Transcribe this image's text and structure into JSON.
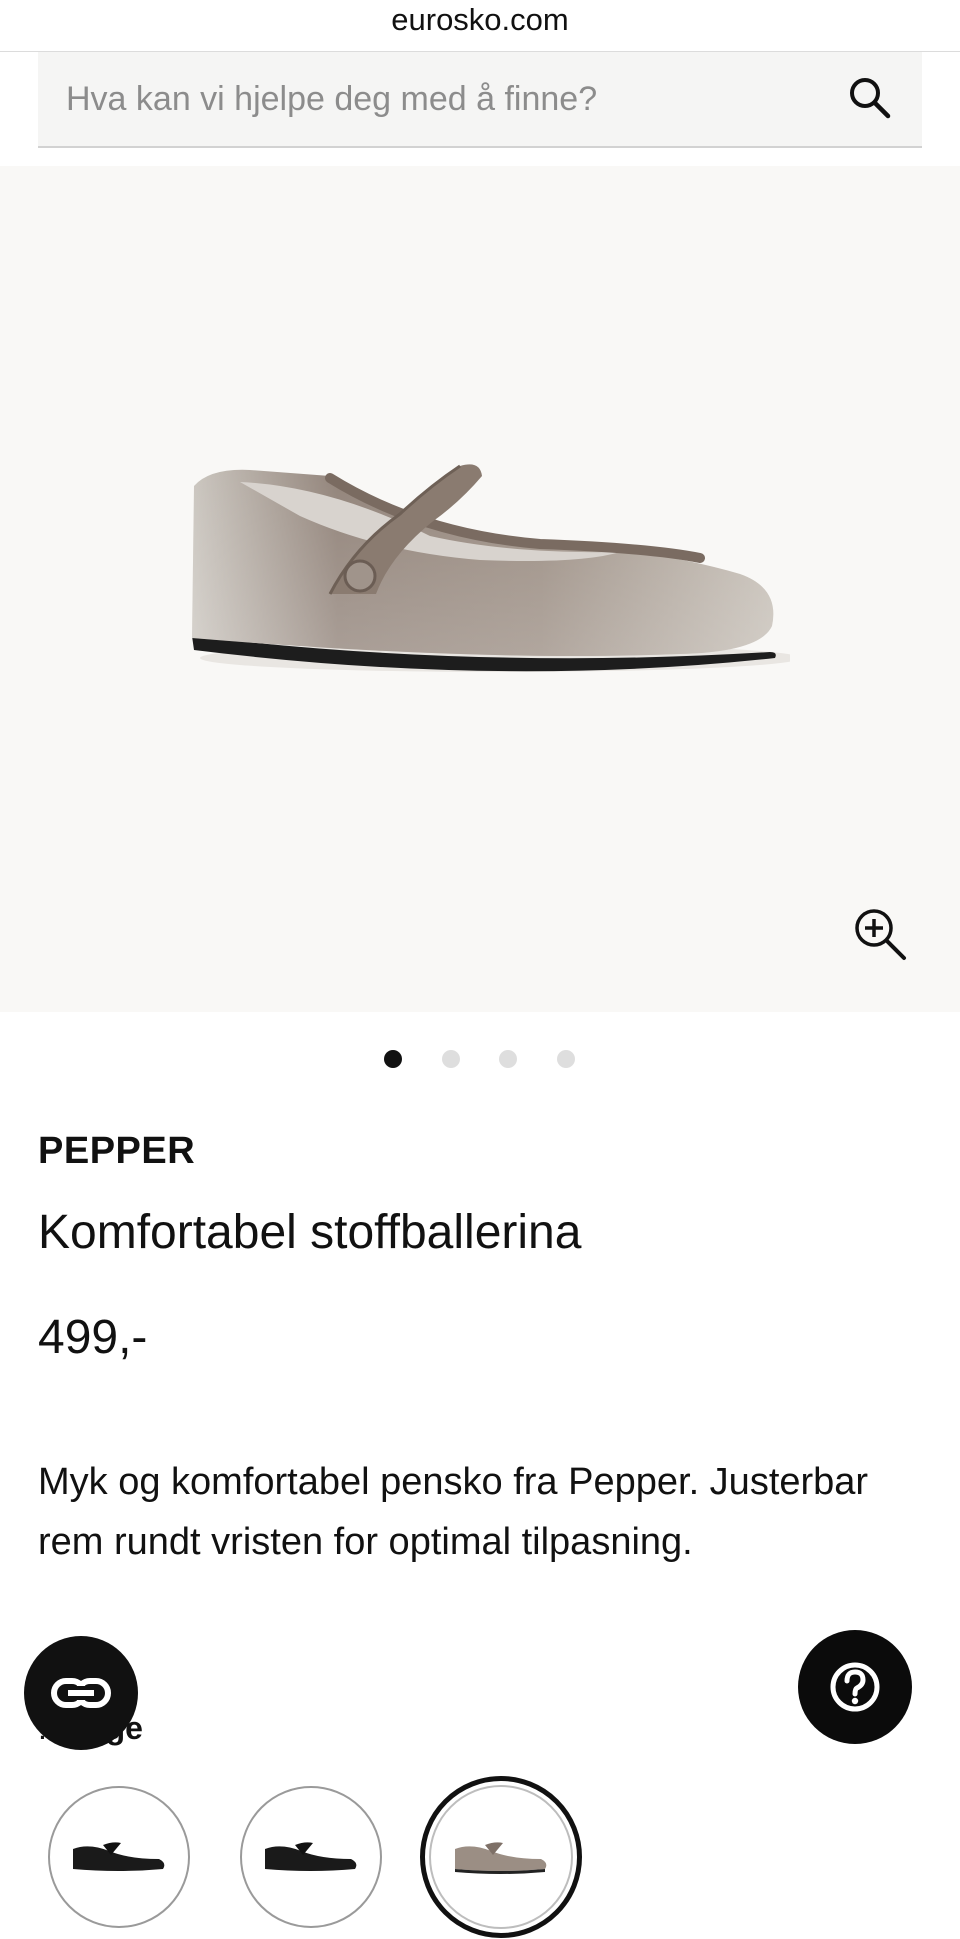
{
  "browser": {
    "url": "eurosko.com"
  },
  "search": {
    "placeholder": "Hva kan vi hjelpe deg med å finne?",
    "icon": "search-icon"
  },
  "gallery": {
    "image": "beige-velvet-mary-jane-shoe",
    "zoom_icon": "zoom-in-icon",
    "dots_total": 4,
    "dots_active": 1
  },
  "product": {
    "brand": "PEPPER",
    "title": "Komfortabel stoffballerina",
    "price": "499,-",
    "description": "Myk og komfortabel pensko fra Pepper. Justerbar rem rundt vristen for optimal tilpasning.",
    "color_label_suffix": ": ",
    "color_value": "Beige"
  },
  "variants": [
    {
      "name": "black-velvet",
      "color": "#1a1a1a"
    },
    {
      "name": "black-velvet-2",
      "color": "#1a1a1a"
    },
    {
      "name": "beige-velvet",
      "color": "#9b8e84",
      "selected": true
    }
  ],
  "floating": {
    "left_icon": "link-icon",
    "right_icon": "help-icon"
  },
  "colors": {
    "accent": "#111111",
    "gallery_bg": "#f9f8f6",
    "search_bg": "#f5f5f4"
  }
}
